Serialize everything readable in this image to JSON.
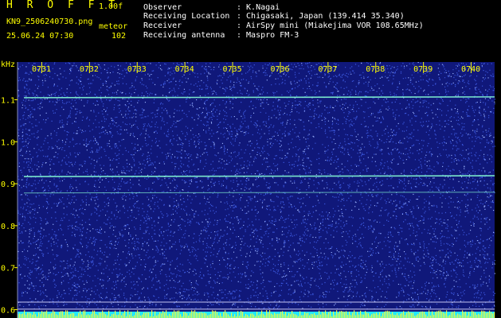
{
  "header": {
    "title": "H R O F F T",
    "version": "1.00f",
    "filename": "KN9_2506240730.png",
    "meteor_label": "meteor",
    "datetime": "25.06.24 07:30",
    "count": "102"
  },
  "metadata": [
    {
      "label": "Observer",
      "value": ": K.Nagai"
    },
    {
      "label": "Receiving Location",
      "value": ": Chigasaki, Japan (139.414 35.340)"
    },
    {
      "label": "Receiver",
      "value": ": AirSpy mini (Miakejima VOR 108.65MHz)"
    },
    {
      "label": "Receiving antenna",
      "value": ": Maspro FM-3"
    }
  ],
  "colors": {
    "background": "#000000",
    "plot_background": "#10187a",
    "noise_light": "#4a6cff",
    "noise_white": "#cfe0ff",
    "signal": "#7ff0d0",
    "axis_text": "#ffff00",
    "bottom_strip": "#20e8ff",
    "bottom_spikes": "#ffff30",
    "guide_line": "#d8d8ff"
  },
  "chart_data": {
    "type": "heatmap",
    "title": "",
    "xlabel": "",
    "ylabel": "kHz",
    "x_ticks": [
      "0731",
      "0732",
      "0733",
      "0734",
      "0735",
      "0736",
      "0737",
      "0738",
      "0739",
      "0740"
    ],
    "y_ticks": [
      "1.1",
      "1.0",
      "0.9",
      "0.8",
      "0.7",
      "0.6"
    ],
    "ylim": [
      0.58,
      1.19
    ],
    "xlim_minutes": [
      30.5,
      40.5
    ],
    "signal_lines_khz": [
      1.105,
      0.917,
      0.878
    ],
    "guide_lines_khz": [
      0.618,
      0.601
    ]
  }
}
